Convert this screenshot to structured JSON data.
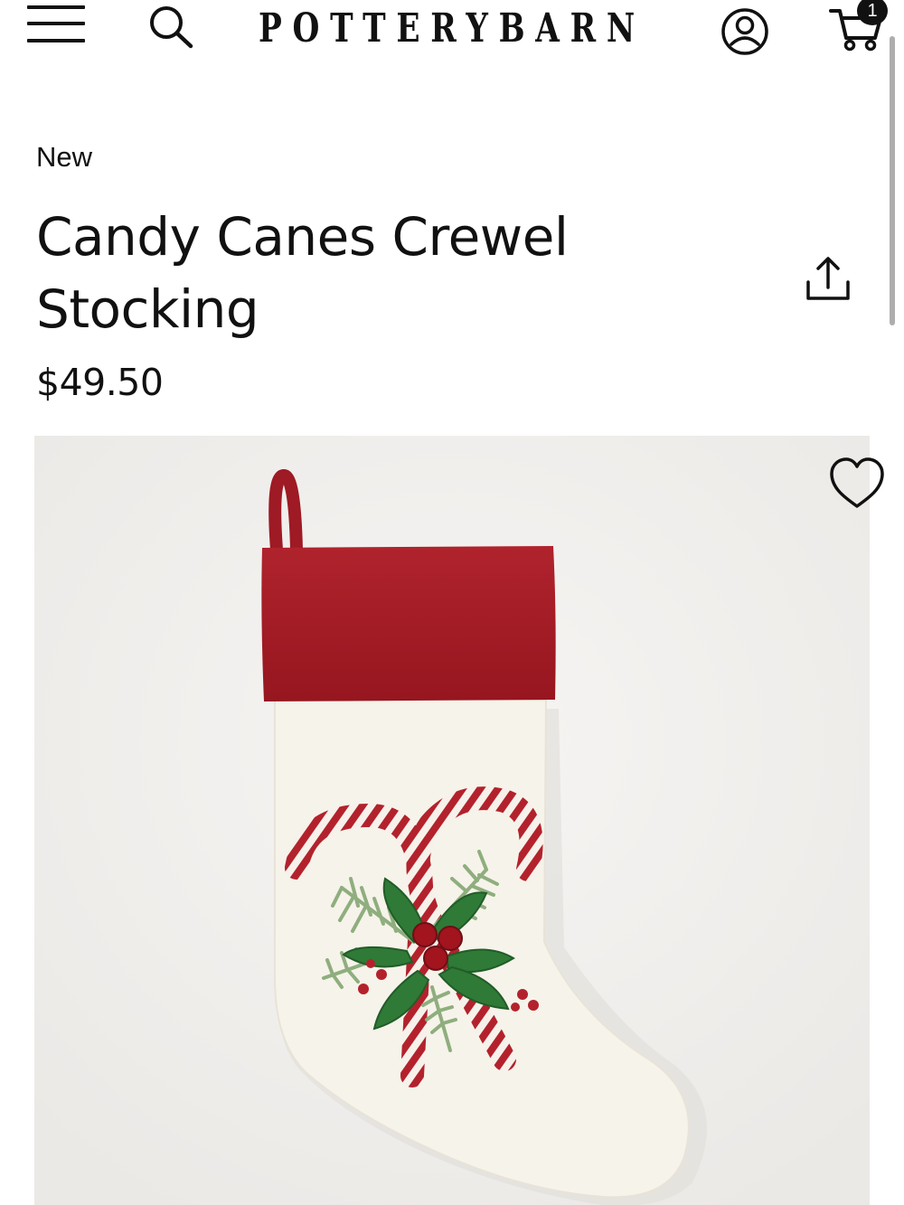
{
  "header": {
    "logo_text": "POTTERYBARN",
    "cart_count": "1",
    "icons": {
      "menu": "hamburger-menu-icon",
      "search": "search-icon",
      "account": "user-account-icon",
      "cart": "shopping-cart-icon"
    }
  },
  "product": {
    "badge": "New",
    "title": "Candy Canes Crewel Stocking",
    "price": "$49.50",
    "icons": {
      "share": "share-icon",
      "wishlist": "heart-icon"
    }
  },
  "colors": {
    "text": "#111111",
    "stocking_cuff": "#a51d26",
    "stocking_body": "#f6f3ea",
    "candy_cane_red": "#b3222c",
    "holly_green": "#2f7a36",
    "image_background": "#f2f1ef"
  }
}
